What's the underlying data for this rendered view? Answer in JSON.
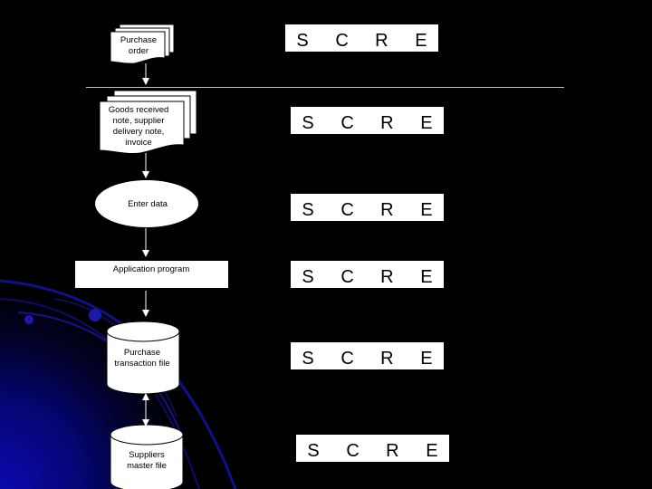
{
  "slide": {
    "background_color": "#000000",
    "accent_color": "#1a1aa8",
    "divider_color": "#bfbfbf"
  },
  "flowchart": {
    "nodes": [
      {
        "id": "purchase-order",
        "shape": "multi-document",
        "lines": [
          "Purchase",
          "order"
        ]
      },
      {
        "id": "goods-received",
        "shape": "multi-document",
        "lines": [
          "Goods received",
          "note, supplier",
          "delivery note,",
          "invoice"
        ]
      },
      {
        "id": "enter-data",
        "shape": "ellipse",
        "lines": [
          "Enter data"
        ]
      },
      {
        "id": "application-program",
        "shape": "process",
        "lines": [
          "Application program"
        ]
      },
      {
        "id": "purchase-transaction-file",
        "shape": "cylinder",
        "lines": [
          "Purchase",
          "transaction file"
        ]
      },
      {
        "id": "suppliers-master-file",
        "shape": "cylinder",
        "lines": [
          "Suppliers",
          "master file"
        ]
      }
    ],
    "edges": [
      {
        "from": "purchase-order",
        "to": "goods-received",
        "direction": "forward"
      },
      {
        "from": "goods-received",
        "to": "enter-data",
        "direction": "forward"
      },
      {
        "from": "enter-data",
        "to": "application-program",
        "direction": "forward"
      },
      {
        "from": "application-program",
        "to": "purchase-transaction-file",
        "direction": "forward"
      },
      {
        "from": "purchase-transaction-file",
        "to": "suppliers-master-file",
        "direction": "both"
      }
    ]
  },
  "scre_rows": [
    {
      "letters": [
        "S",
        "C",
        "R",
        "E"
      ]
    },
    {
      "letters": [
        "S",
        "C",
        "R",
        "E"
      ]
    },
    {
      "letters": [
        "S",
        "C",
        "R",
        "E"
      ]
    },
    {
      "letters": [
        "S",
        "C",
        "R",
        "E"
      ]
    },
    {
      "letters": [
        "S",
        "C",
        "R",
        "E"
      ]
    },
    {
      "letters": [
        "S",
        "C",
        "R",
        "E"
      ]
    }
  ]
}
